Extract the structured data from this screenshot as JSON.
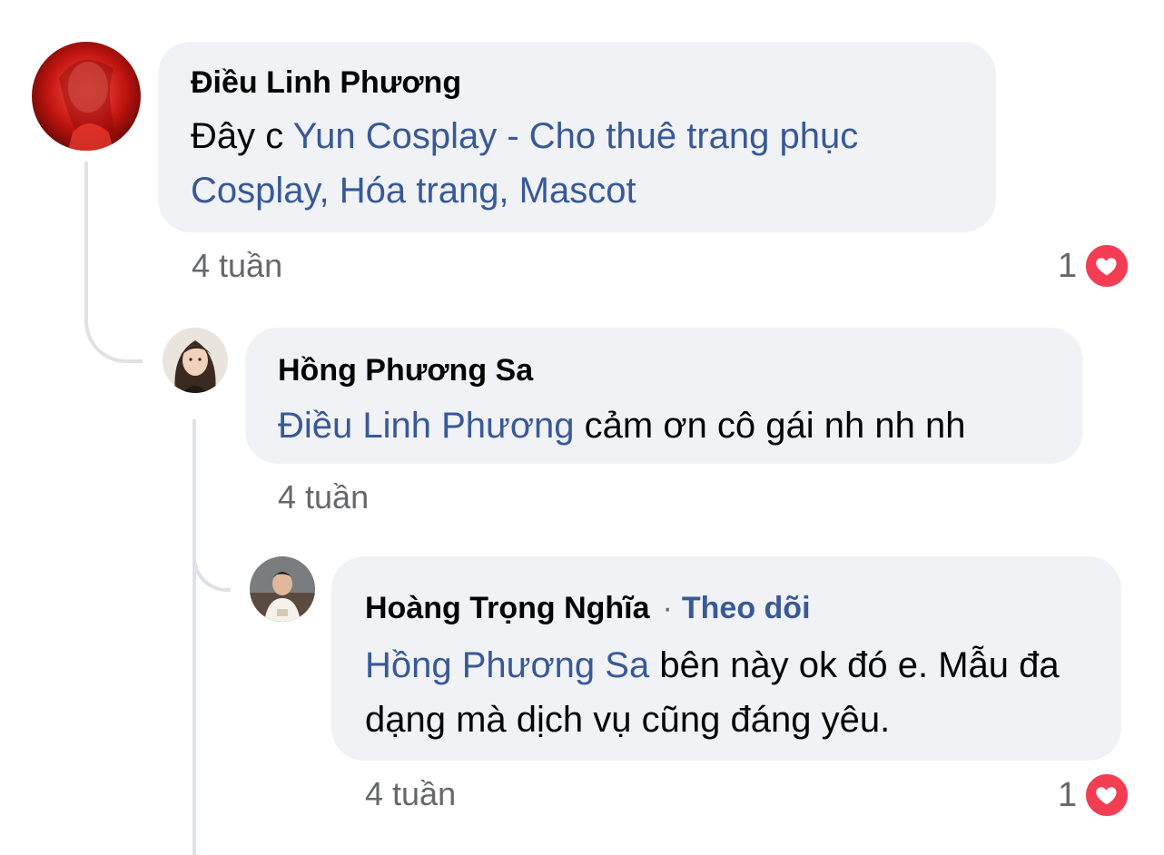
{
  "comments": [
    {
      "author": "Điều Linh Phương",
      "text_prefix": "Đây c ",
      "mention": "Yun Cosplay - Cho thuê trang phục Cosplay, Hóa trang, Mascot",
      "text_suffix": "",
      "time": "4 tuần",
      "reaction_count": "1",
      "reaction_icon": "heart-icon"
    },
    {
      "author": "Hồng Phương Sa",
      "text_prefix": "",
      "mention": "Điều Linh Phương",
      "text_suffix": " cảm ơn cô gái nh nh nh",
      "time": "4 tuần"
    },
    {
      "author": "Hoàng Trọng Nghĩa",
      "separator": "·",
      "follow_label": "Theo dõi",
      "text_prefix": "",
      "mention": "Hồng Phương Sa",
      "text_suffix": " bên này ok đó e. Mẫu đa dạng mà dịch vụ cũng đáng yêu.",
      "time": "4 tuần",
      "reaction_count": "1",
      "reaction_icon": "heart-icon"
    }
  ],
  "colors": {
    "bubble": "#f0f2f5",
    "link": "#385898",
    "meta": "#65676b",
    "heart": "#f23d52",
    "thread_line": "#dfe1e6"
  }
}
